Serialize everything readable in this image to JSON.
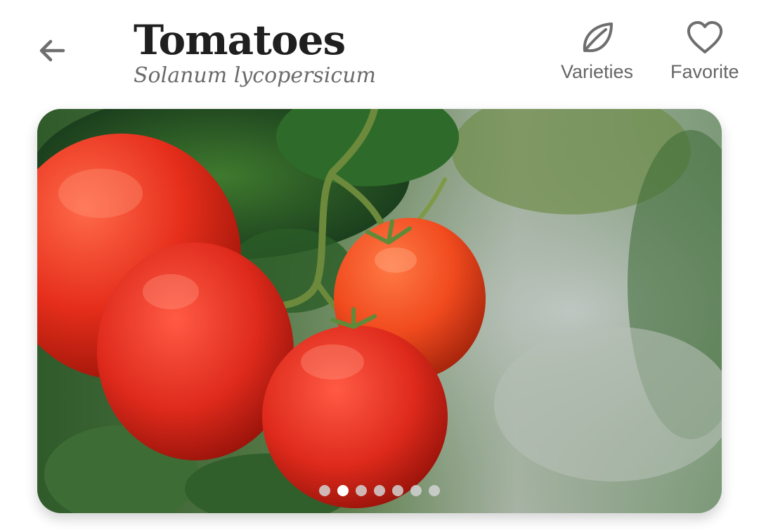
{
  "header": {
    "title": "Tomatoes",
    "scientific_name": "Solanum lycopersicum",
    "back_icon": "arrow-left-icon"
  },
  "actions": [
    {
      "label": "Varieties",
      "icon": "leaf-icon"
    },
    {
      "label": "Favorite",
      "icon": "heart-outline-icon"
    }
  ],
  "carousel": {
    "image_subject": "tomatoes",
    "slide_count": 7,
    "active_index": 1
  },
  "colors": {
    "title": "#1f1f1f",
    "subtitle": "#6b6b6b",
    "icon": "#6e6e6e",
    "dot_active": "#ffffff",
    "dot_inactive": "#d2d2d2"
  }
}
